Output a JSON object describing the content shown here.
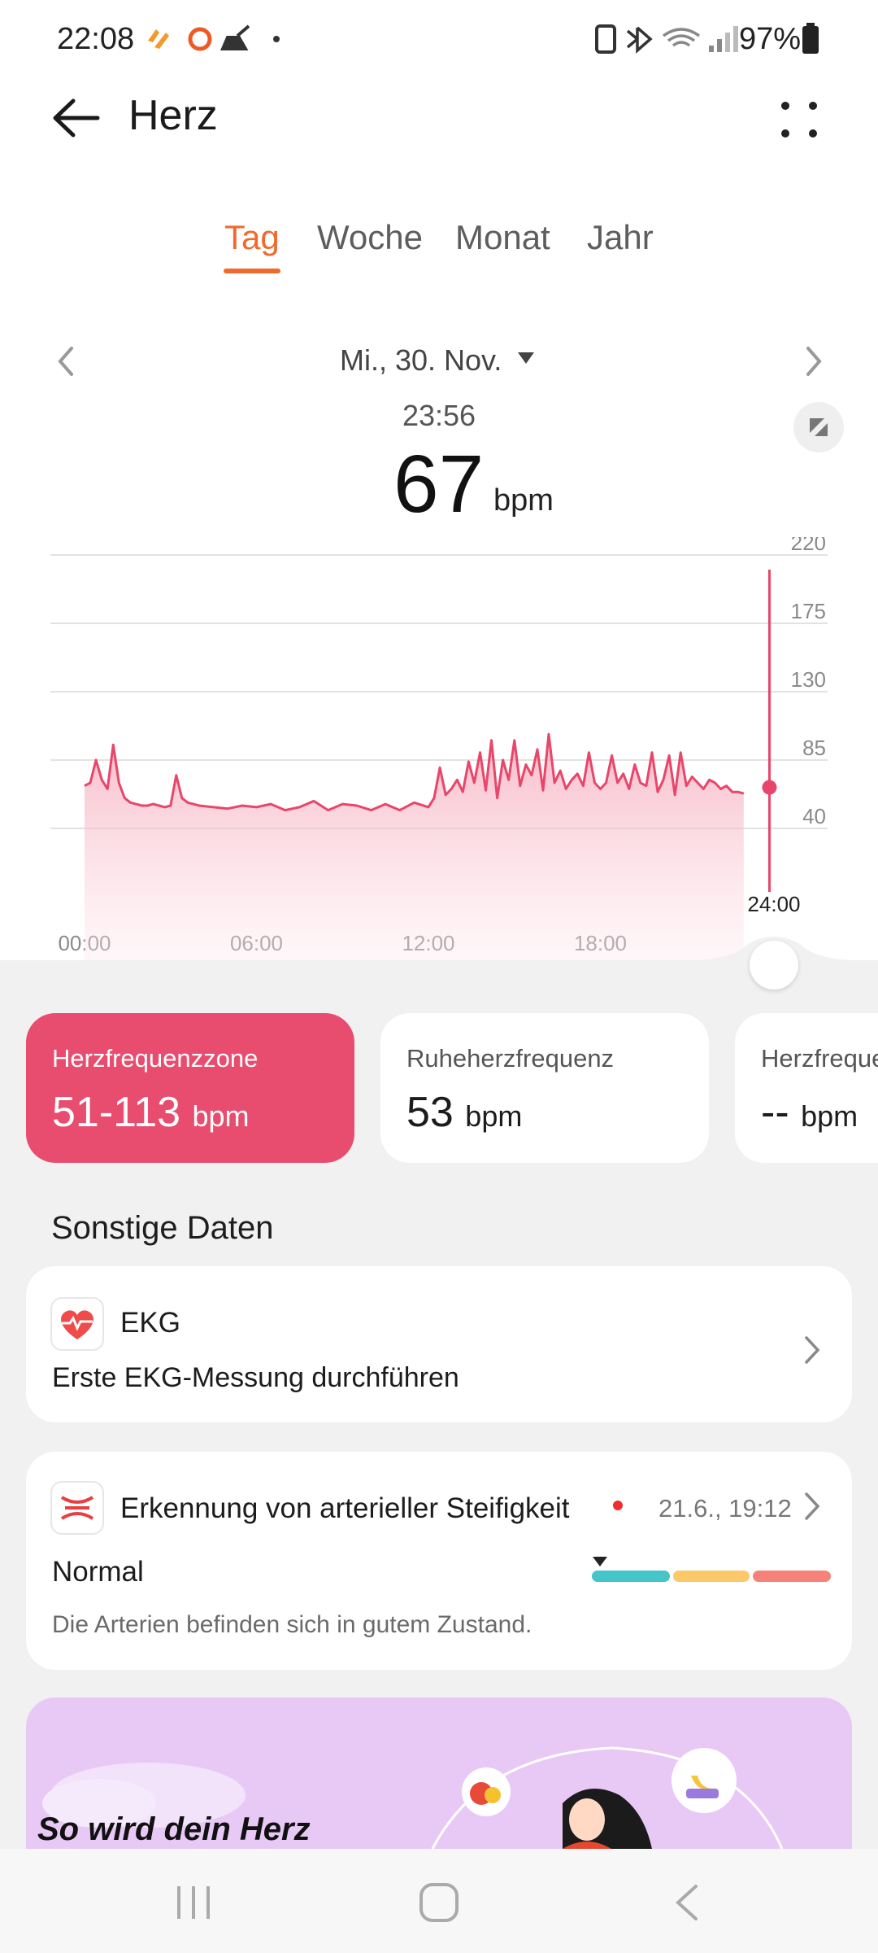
{
  "status_bar": {
    "time": "22:08",
    "battery": "97%"
  },
  "header": {
    "title": "Herz"
  },
  "tabs": [
    {
      "label": "Tag",
      "active": true
    },
    {
      "label": "Woche",
      "active": false
    },
    {
      "label": "Monat",
      "active": false
    },
    {
      "label": "Jahr",
      "active": false
    }
  ],
  "date_nav": {
    "date": "Mi., 30. Nov.",
    "time": "23:56",
    "value": "67",
    "unit": "bpm"
  },
  "chart_data": {
    "type": "area",
    "y_ticks": [
      "220",
      "175",
      "130",
      "85",
      "40"
    ],
    "x_ticks": [
      "00:00",
      "06:00",
      "12:00",
      "18:00",
      "24:00"
    ],
    "ylim": [
      40,
      220
    ],
    "series": [
      {
        "x": [
          0,
          0.2,
          0.4,
          0.6,
          0.8,
          1.0,
          1.2,
          1.4,
          1.6,
          1.8,
          2.0,
          2.2,
          2.4,
          2.6,
          2.8,
          3.0,
          3.2,
          3.4,
          3.6,
          3.8,
          4.0,
          4.5,
          5.0,
          5.5,
          6.0,
          6.5,
          7.0,
          7.5,
          8.0,
          8.5,
          9.0,
          9.5,
          10.0,
          10.5,
          11.0,
          11.5,
          12.0,
          12.2,
          12.4,
          12.6,
          12.8,
          13.0,
          13.2,
          13.4,
          13.6,
          13.8,
          14.0,
          14.2,
          14.4,
          14.6,
          14.8,
          15.0,
          15.2,
          15.4,
          15.6,
          15.8,
          16.0,
          16.2,
          16.4,
          16.6,
          16.8,
          17.0,
          17.2,
          17.4,
          17.6,
          17.8,
          18.0,
          18.2,
          18.4,
          18.6,
          18.8,
          19.0,
          19.2,
          19.4,
          19.6,
          19.8,
          20.0,
          20.2,
          20.4,
          20.6,
          20.8,
          21.0,
          21.2,
          21.4,
          21.6,
          21.8,
          22.0,
          22.2,
          22.4,
          22.6,
          22.8,
          23.0
        ],
        "y": [
          68,
          70,
          85,
          72,
          66,
          95,
          70,
          60,
          57,
          56,
          55,
          55,
          56,
          55,
          54,
          55,
          75,
          60,
          57,
          56,
          55,
          54,
          53,
          55,
          54,
          56,
          52,
          54,
          58,
          52,
          56,
          55,
          52,
          56,
          52,
          57,
          54,
          60,
          80,
          62,
          66,
          72,
          64,
          84,
          70,
          90,
          65,
          98,
          60,
          85,
          72,
          98,
          68,
          82,
          75,
          92,
          65,
          102,
          70,
          78,
          66,
          72,
          76,
          68,
          90,
          70,
          66,
          70,
          88,
          70,
          76,
          66,
          82,
          70,
          68,
          90,
          64,
          72,
          88,
          62,
          90,
          68,
          74,
          70,
          66,
          72,
          70,
          66,
          68,
          64,
          64,
          63
        ],
        "color": "#e8466a"
      }
    ],
    "current_point": {
      "x": 23.9,
      "y": 67
    }
  },
  "cards": [
    {
      "title": "Herzfrequenzzone",
      "value": "51-113",
      "unit": "bpm"
    },
    {
      "title": "Ruheherzfrequenz",
      "value": "53",
      "unit": "bpm"
    },
    {
      "title": "Herzfrequenz",
      "value": "--",
      "unit": "bpm"
    }
  ],
  "sonstige": {
    "title": "Sonstige Daten",
    "ekg": {
      "title": "EKG",
      "subtitle": "Erste EKG-Messung durchführen"
    },
    "arterial": {
      "title": "Erkennung von arterieller Steifigkeit",
      "date": "21.6., 19:12",
      "status": "Normal",
      "description": "Die Arterien befinden sich in gutem Zustand.",
      "level_colors": [
        "#45c4c9",
        "#fbc86a",
        "#f7827a"
      ]
    }
  },
  "banner": {
    "text": "So wird dein Herz"
  },
  "colors": {
    "accent": "#ef6a2c",
    "heart": "#e8466a"
  }
}
